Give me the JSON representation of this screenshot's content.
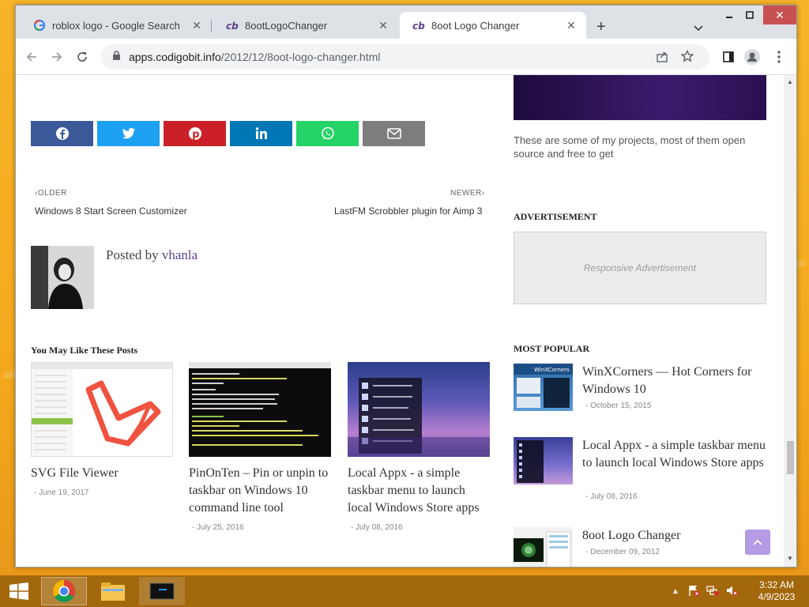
{
  "browser": {
    "tabs": [
      {
        "title": "roblox logo - Google Search",
        "favicon": "google-g-icon",
        "active": false
      },
      {
        "title": "8ootLogoChanger",
        "favicon": "codigobit-icon",
        "active": false
      },
      {
        "title": "8oot Logo Changer",
        "favicon": "codigobit-icon",
        "active": true
      }
    ],
    "url_host": "apps.codigobit.info",
    "url_path": "/2012/12/8oot-logo-changer.html"
  },
  "post_nav": {
    "older_label": "OLDER",
    "older_title": "Windows 8 Start Screen Customizer",
    "newer_label": "NEWER",
    "newer_title": "LastFM Scrobbler plugin for Aimp 3"
  },
  "share_buttons": [
    {
      "name": "facebook",
      "color": "#3b5998"
    },
    {
      "name": "twitter",
      "color": "#1da1f2"
    },
    {
      "name": "pinterest",
      "color": "#cb2027"
    },
    {
      "name": "linkedin",
      "color": "#0077b5"
    },
    {
      "name": "whatsapp",
      "color": "#25d366"
    },
    {
      "name": "email",
      "color": "#7d7d7d"
    }
  ],
  "author": {
    "posted_by": "Posted by",
    "name": "vhanla"
  },
  "related": {
    "heading": "You May Like These Posts",
    "posts": [
      {
        "title": "SVG File Viewer",
        "date": "- June 19, 2017"
      },
      {
        "title": "PinOnTen – Pin or unpin to taskbar on Windows 10 command line tool",
        "date": "- July 25, 2016"
      },
      {
        "title": "Local Appx - a simple taskbar menu to launch local Windows Store apps",
        "date": "- July 08, 2016"
      }
    ]
  },
  "sidebar": {
    "projects_text": "These are some of my projects, most of them open source and free to get",
    "ad_heading": "ADVERTISEMENT",
    "ad_text": "Responsive Advertisement",
    "popular_heading": "MOST POPULAR",
    "popular": [
      {
        "title": "WinXCorners — Hot Corners for Windows 10",
        "date": "- October 15, 2015"
      },
      {
        "title": "Local Appx - a simple taskbar menu to launch local Windows Store apps",
        "date": "- July 08, 2016"
      },
      {
        "title": "8oot Logo Changer",
        "date": "- December 09, 2012"
      }
    ]
  },
  "taskbar": {
    "time": "3:32 AM",
    "date": "4/9/2023"
  }
}
